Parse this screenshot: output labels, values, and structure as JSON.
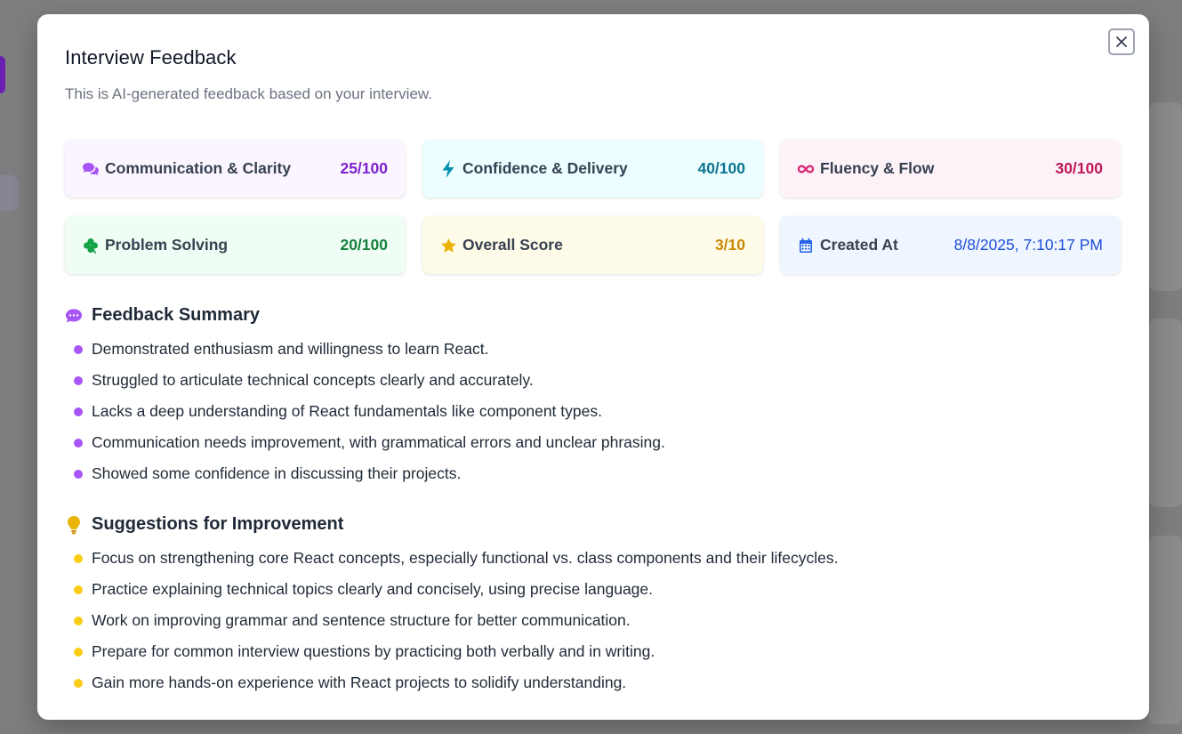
{
  "modal": {
    "title": "Interview Feedback",
    "subtitle": "This is AI-generated feedback based on your interview."
  },
  "metrics": [
    {
      "label": "Communication & Clarity",
      "value": "25/100",
      "icon": "comments-icon",
      "bg": "#faf5ff",
      "color": "#7e22ce",
      "icon_color": "#a855f7"
    },
    {
      "label": "Confidence & Delivery",
      "value": "40/100",
      "icon": "bolt-icon",
      "bg": "#ecfeff",
      "color": "#0e7490",
      "icon_color": "#0891b2"
    },
    {
      "label": "Fluency & Flow",
      "value": "30/100",
      "icon": "infinity-icon",
      "bg": "#fdf2f8",
      "color": "#be185d",
      "icon_color": "#db2777"
    },
    {
      "label": "Problem Solving",
      "value": "20/100",
      "icon": "clover-icon",
      "bg": "#f0fdf4",
      "color": "#15803d",
      "icon_color": "#16a34a"
    },
    {
      "label": "Overall Score",
      "value": "3/10",
      "icon": "star-icon",
      "bg": "#fefce8",
      "color": "#ca8a04",
      "icon_color": "#eab308"
    },
    {
      "label": "Created At",
      "value": "8/8/2025, 7:10:17 PM",
      "icon": "calendar-icon",
      "bg": "#eff6ff",
      "color": "#1d4ed8",
      "icon_color": "#2563eb"
    }
  ],
  "summary": {
    "title": "Feedback Summary",
    "icon": "comment-dots-icon",
    "accent": "#a855f7",
    "items": [
      "Demonstrated enthusiasm and willingness to learn React.",
      "Struggled to articulate technical concepts clearly and accurately.",
      "Lacks a deep understanding of React fundamentals like component types.",
      "Communication needs improvement, with grammatical errors and unclear phrasing.",
      "Showed some confidence in discussing their projects."
    ]
  },
  "suggestions": {
    "title": "Suggestions for Improvement",
    "icon": "lightbulb-icon",
    "accent": "#facc15",
    "items": [
      "Focus on strengthening core React concepts, especially functional vs. class components and their lifecycles.",
      "Practice explaining technical topics clearly and concisely, using precise language.",
      "Work on improving grammar and sentence structure for better communication.",
      "Prepare for common interview questions by practicing both verbally and in writing.",
      "Gain more hands-on experience with React projects to solidify understanding."
    ]
  }
}
